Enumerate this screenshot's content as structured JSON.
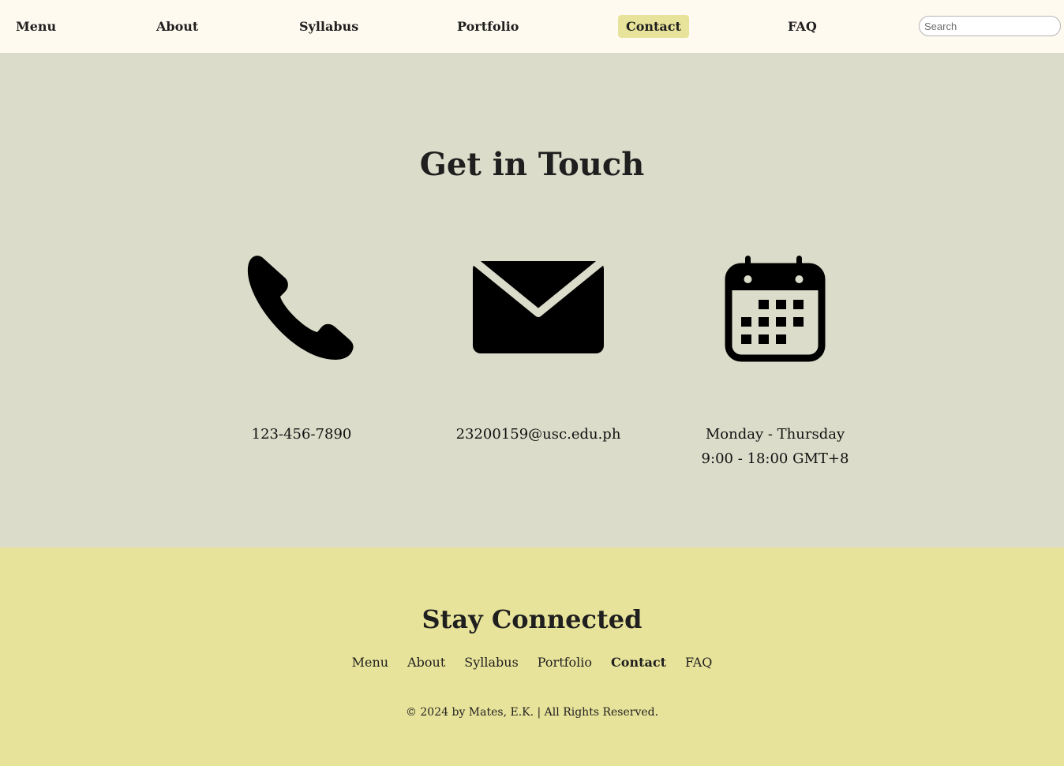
{
  "nav": {
    "items": [
      {
        "label": "Menu"
      },
      {
        "label": "About"
      },
      {
        "label": "Syllabus"
      },
      {
        "label": "Portfolio"
      },
      {
        "label": "Contact",
        "active": true
      },
      {
        "label": "FAQ"
      }
    ],
    "search_placeholder": "Search"
  },
  "contact": {
    "title": "Get in Touch",
    "cards": [
      {
        "icon": "phone-icon",
        "lines": [
          "123-456-7890"
        ]
      },
      {
        "icon": "envelope-icon",
        "lines": [
          "23200159@usc.edu.ph"
        ]
      },
      {
        "icon": "calendar-icon",
        "lines": [
          "Monday - Thursday",
          "9:00 - 18:00 GMT+8"
        ]
      }
    ]
  },
  "footer": {
    "title": "Stay Connected",
    "links": [
      {
        "label": "Menu"
      },
      {
        "label": "About"
      },
      {
        "label": "Syllabus"
      },
      {
        "label": "Portfolio"
      },
      {
        "label": "Contact",
        "active": true
      },
      {
        "label": "FAQ"
      }
    ],
    "copyright": "© 2024 by Mates, E.K. | All Rights Reserved."
  },
  "colors": {
    "nav_bg": "#fffaf0",
    "section_bg": "#dcdcca",
    "footer_bg": "#e8e39a",
    "active_bg": "#e8e39a",
    "text": "#1f1f1f"
  }
}
